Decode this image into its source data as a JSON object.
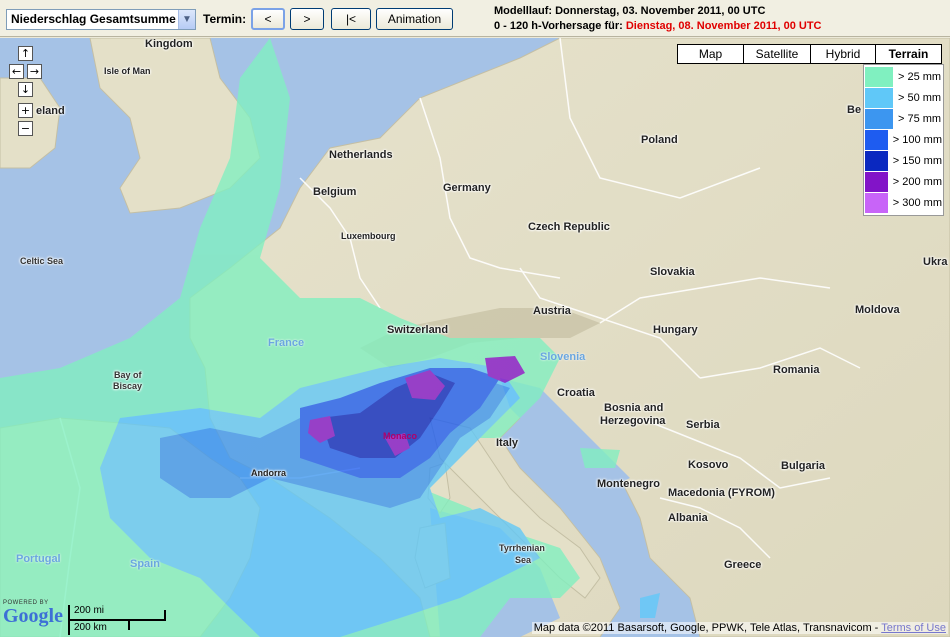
{
  "toolbar": {
    "product_select": "Niederschlag Gesamtsumme",
    "termin_label": "Termin:",
    "btn_prev": "<",
    "btn_next": ">",
    "btn_first": "|<",
    "btn_animation": "Animation"
  },
  "info": {
    "model_run": "Modelllauf: Donnerstag, 03. November 2011, 00 UTC",
    "forecast_prefix": "0 - 120 h-Vorhersage für:",
    "forecast_date": "Dienstag, 08. November 2011, 00 UTC"
  },
  "map_types": [
    "Map",
    "Satellite",
    "Hybrid",
    "Terrain"
  ],
  "map_type_selected": "Terrain",
  "legend": [
    {
      "label": "> 25 mm",
      "color": "#80f0c0"
    },
    {
      "label": "> 50 mm",
      "color": "#60c8f8"
    },
    {
      "label": "> 75 mm",
      "color": "#3c96f0"
    },
    {
      "label": "> 100 mm",
      "color": "#1e5cf0"
    },
    {
      "label": "> 150 mm",
      "color": "#0a28c0"
    },
    {
      "label": "> 200 mm",
      "color": "#8214c8"
    },
    {
      "label": "> 300 mm",
      "color": "#c864f8"
    }
  ],
  "nav": {
    "up": "↑",
    "left": "←",
    "right": "→",
    "down": "↓",
    "zoom_in": "+",
    "zoom_out": "−"
  },
  "places": {
    "kingdom": "Kingdom",
    "isle_of_man": "Isle of Man",
    "ireland": "eland",
    "celtic_sea": "Celtic Sea",
    "netherlands": "Netherlands",
    "belgium": "Belgium",
    "luxembourg": "Luxembourg",
    "germany": "Germany",
    "poland": "Poland",
    "czech": "Czech Republic",
    "slovakia": "Slovakia",
    "austria": "Austria",
    "switzerland": "Switzerland",
    "france": "France",
    "bay_of_biscay_1": "Bay of",
    "bay_of_biscay_2": "Biscay",
    "slovenia": "Slovenia",
    "hungary": "Hungary",
    "croatia": "Croatia",
    "bosnia_1": "Bosnia and",
    "bosnia_2": "Herzegovina",
    "serbia": "Serbia",
    "romania": "Romania",
    "moldova": "Moldova",
    "ukraine": "Ukra",
    "belarus": "Be",
    "monaco": "Monaco",
    "italy": "Italy",
    "andorra": "Andorra",
    "montenegro": "Montenegro",
    "kosovo": "Kosovo",
    "bulgaria": "Bulgaria",
    "macedonia": "Macedonia (FYROM)",
    "albania": "Albania",
    "greece": "Greece",
    "portugal": "Portugal",
    "spain": "Spain",
    "tyrrhenian_1": "Tyrrhenian",
    "tyrrhenian_2": "Sea"
  },
  "logo": {
    "powered_by": "POWERED BY",
    "google": "Google"
  },
  "scale": {
    "miles": "200 mi",
    "km": "200 km"
  },
  "copyright": {
    "text": "Map data ©2011 Basarsoft, Google, PPWK, Tele Atlas, Transnavicom - ",
    "terms": "Terms of Use"
  }
}
